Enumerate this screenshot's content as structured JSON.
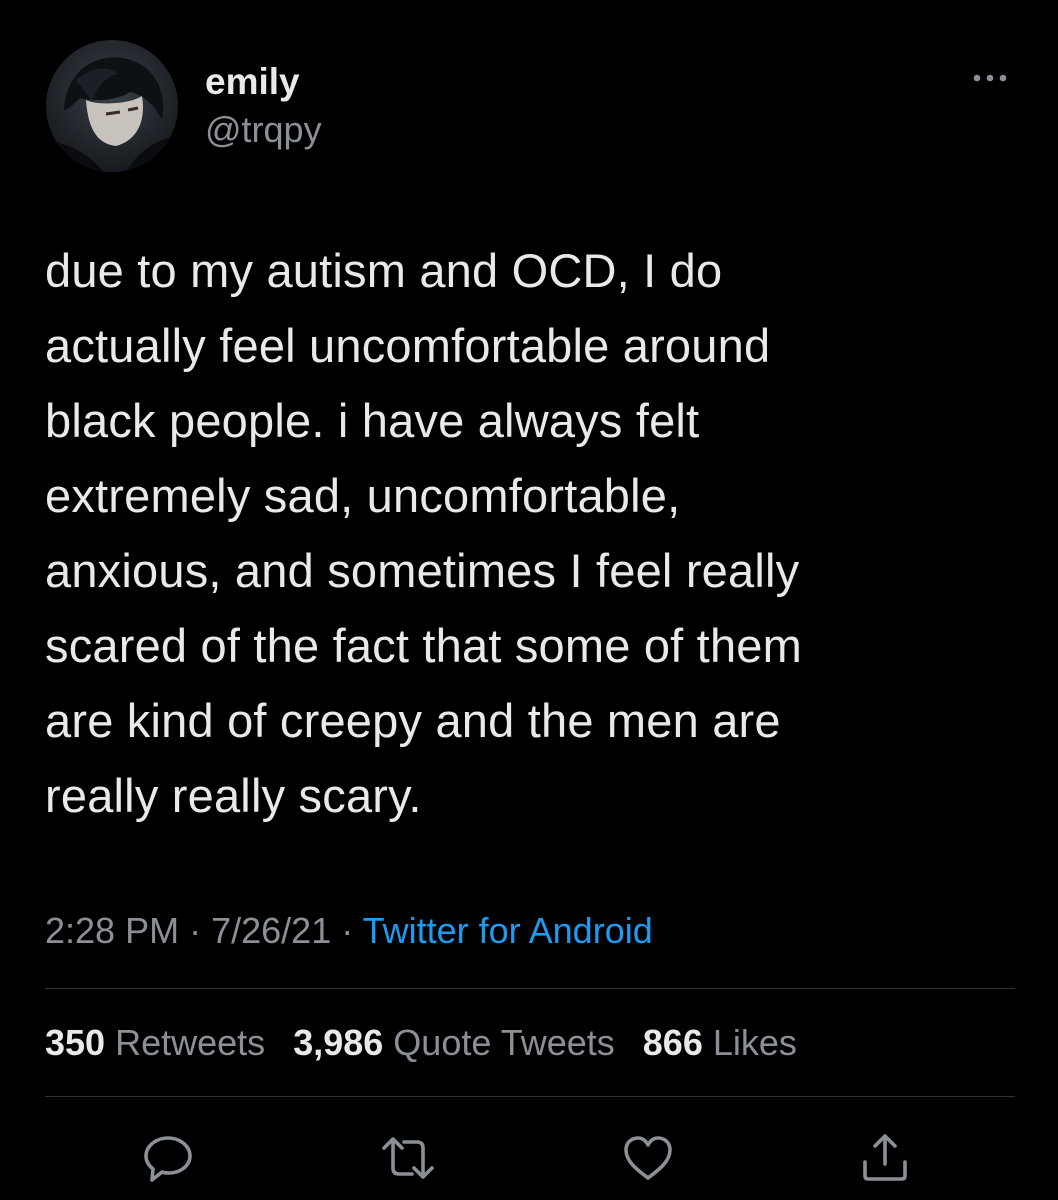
{
  "user": {
    "display_name": "emily",
    "handle": "@trqpy"
  },
  "tweet": {
    "text": "due to my autism and OCD, I do\nactually feel uncomfortable around\nblack people. i have always felt\nextremely sad, uncomfortable,\nanxious, and sometimes I feel really\nscared of the fact that some of them\nare kind of creepy and the men are\nreally really scary.",
    "time": "2:28 PM",
    "separator": "·",
    "date": "7/26/21",
    "source": "Twitter for Android"
  },
  "stats": {
    "retweets_count": "350",
    "retweets_label": "Retweets",
    "quotes_count": "3,986",
    "quotes_label": "Quote Tweets",
    "likes_count": "866",
    "likes_label": "Likes"
  },
  "icons": {
    "more": "more-horizontal-icon",
    "reply": "reply-icon",
    "retweet": "retweet-icon",
    "like": "heart-icon",
    "share": "share-icon"
  },
  "colors": {
    "background": "#000000",
    "text": "#e7e9ea",
    "secondary": "#8b9096",
    "link": "#1d9bf0",
    "divider": "#2f3336"
  }
}
